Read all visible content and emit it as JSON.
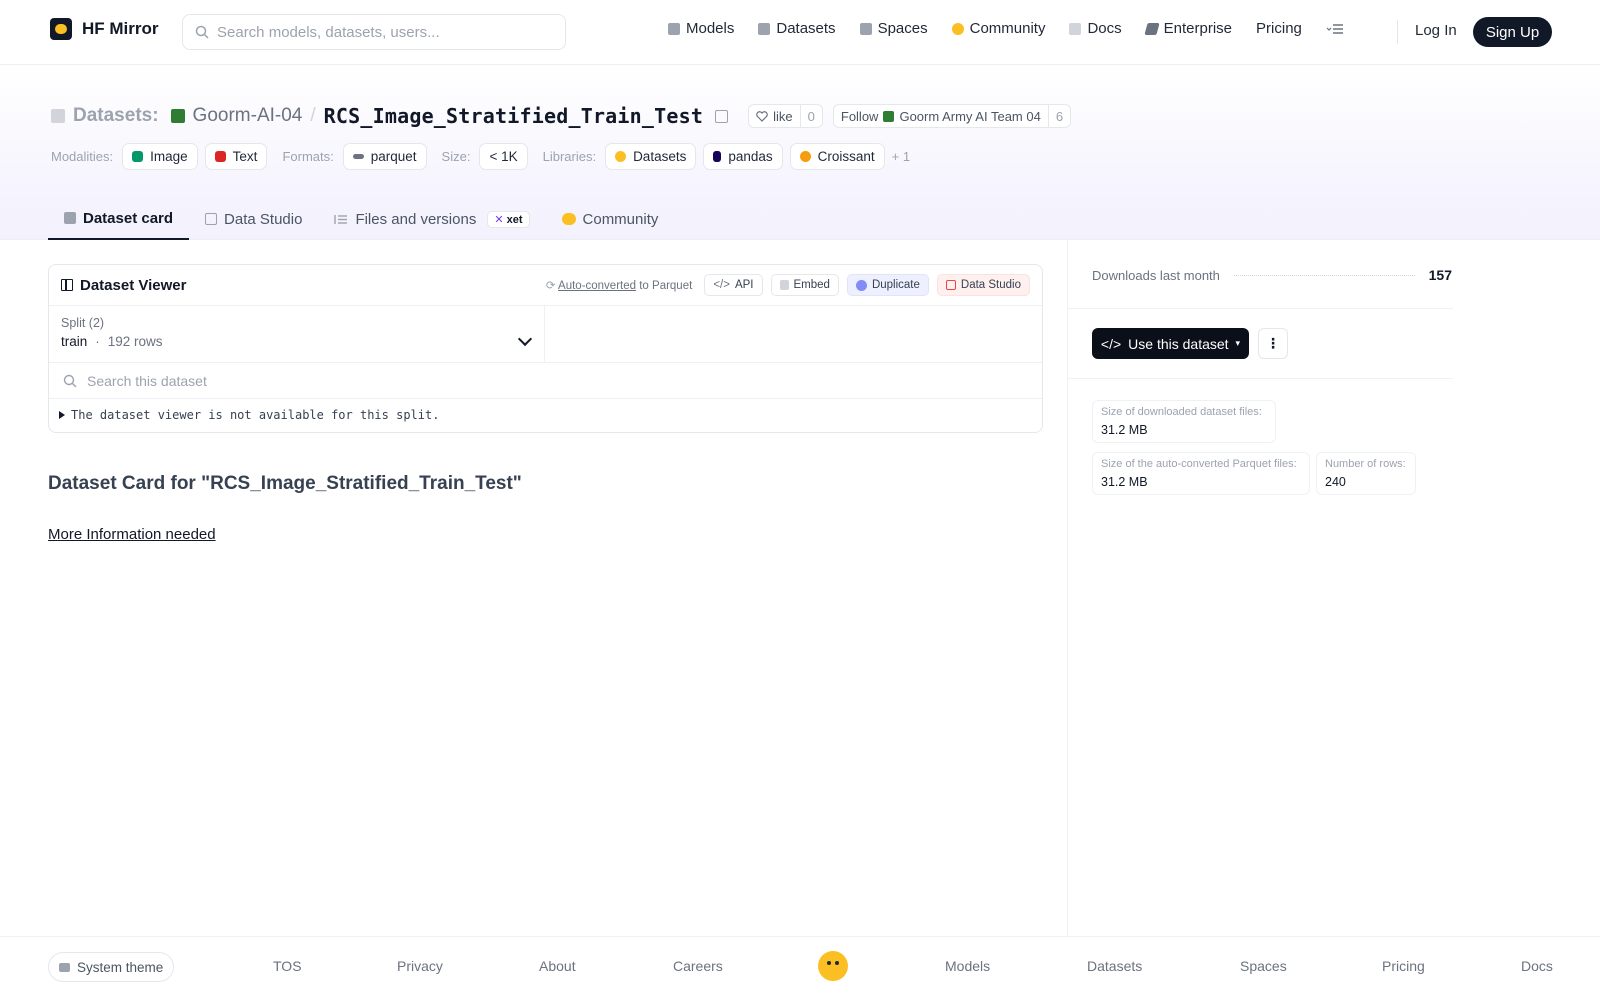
{
  "header": {
    "logo_text": "HF Mirror",
    "search_placeholder": "Search models, datasets, users...",
    "nav": [
      {
        "label": "Models",
        "color": "#9ca3af"
      },
      {
        "label": "Datasets",
        "color": "#9ca3af"
      },
      {
        "label": "Spaces",
        "color": "#9ca3af"
      },
      {
        "label": "Community",
        "color": "#fbbf24"
      },
      {
        "label": "Docs",
        "color": "#9ca3af"
      },
      {
        "label": "Enterprise",
        "color": "#6b7280"
      },
      {
        "label": "Pricing",
        "color": ""
      }
    ],
    "login": "Log In",
    "signup": "Sign Up"
  },
  "repo": {
    "type_label": "Datasets:",
    "org": "Goorm-AI-04",
    "name": "RCS_Image_Stratified_Train_Test",
    "like_label": "like",
    "like_count": "0",
    "follow_label": "Follow",
    "follow_org": "Goorm Army AI Team 04",
    "follow_count": "6"
  },
  "tags": {
    "modalities_label": "Modalities:",
    "modalities": [
      "Image",
      "Text"
    ],
    "formats_label": "Formats:",
    "formats": [
      "parquet"
    ],
    "size_label": "Size:",
    "size": "< 1K",
    "libraries_label": "Libraries:",
    "libraries": [
      "Datasets",
      "pandas",
      "Croissant"
    ],
    "more": "+ 1"
  },
  "tabs": {
    "card": "Dataset card",
    "studio": "Data Studio",
    "files": "Files and versions",
    "xet": "xet",
    "community": "Community"
  },
  "viewer": {
    "title": "Dataset Viewer",
    "autoconverted": "Auto-converted",
    "to_parquet": "to Parquet",
    "api": "API",
    "embed": "Embed",
    "duplicate": "Duplicate",
    "data_studio": "Data Studio",
    "split_label": "Split (2)",
    "split_name": "train",
    "split_dot": "·",
    "split_rows": "192 rows",
    "search_placeholder": "Search this dataset",
    "unavailable": "The dataset viewer is not available for this split."
  },
  "card": {
    "title": "Dataset Card for \"RCS_Image_Stratified_Train_Test\"",
    "more_info": "More Information needed"
  },
  "sidebar": {
    "downloads_label": "Downloads last month",
    "downloads": "157",
    "use_button": "Use this dataset",
    "stats": [
      {
        "label": "Size of downloaded dataset files:",
        "value": "31.2 MB"
      },
      {
        "label": "Size of the auto-converted Parquet files:",
        "value": "31.2 MB"
      },
      {
        "label": "Number of rows:",
        "value": "240"
      }
    ]
  },
  "footer": {
    "theme": "System theme",
    "links": [
      "TOS",
      "Privacy",
      "About",
      "Careers",
      "Models",
      "Datasets",
      "Spaces",
      "Pricing",
      "Docs"
    ]
  }
}
